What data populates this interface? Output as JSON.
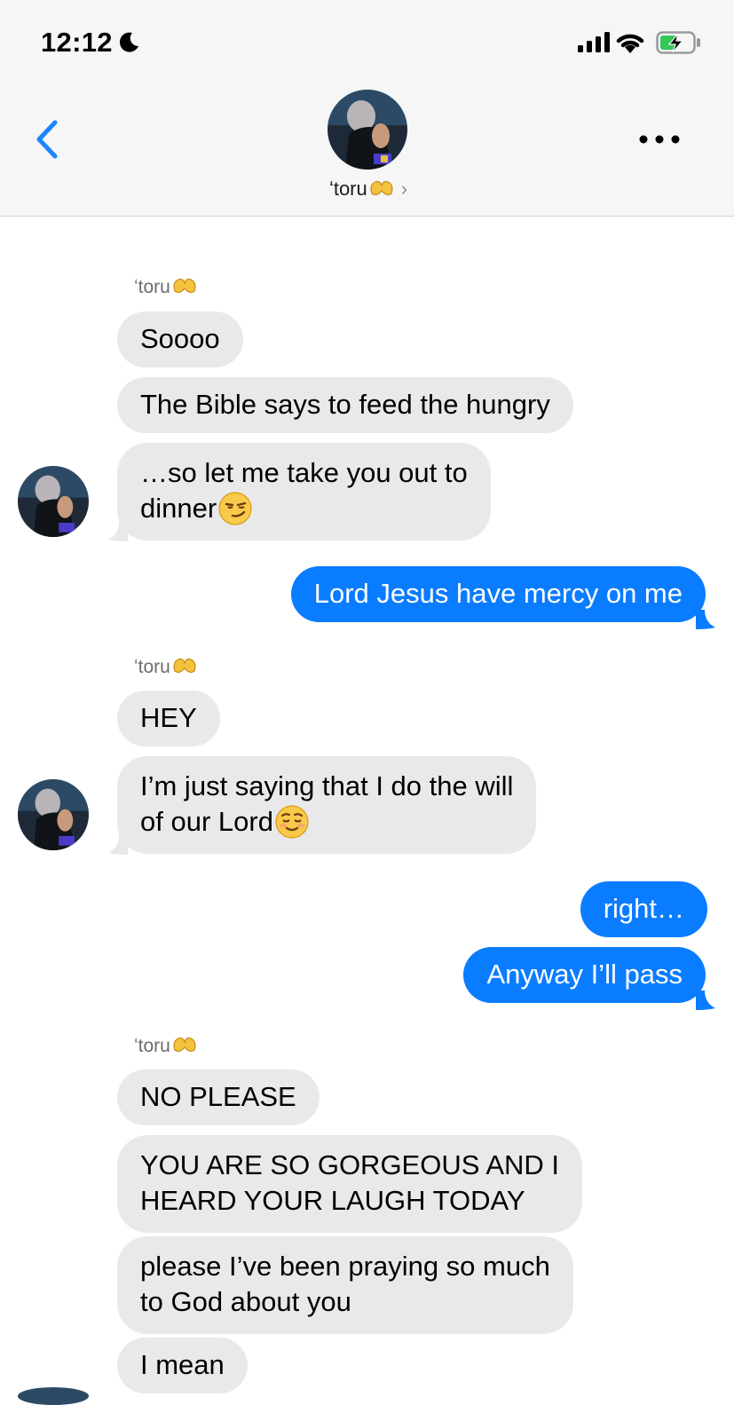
{
  "status_bar": {
    "time": "12:12",
    "icons": [
      "moon-icon",
      "cellular-signal-icon",
      "wifi-icon",
      "battery-charging-icon"
    ]
  },
  "header": {
    "contact_name": "ʻtoru",
    "contact_emoji": "heart-hands-emoji",
    "chevron": "›",
    "back_icon": "chevron-left-icon",
    "menu_icon": "more-dots-icon"
  },
  "colors": {
    "outgoing_bubble": "#0a7cff",
    "incoming_bubble": "#e9e9eb",
    "accent": "#1d84ff"
  },
  "messages": [
    {
      "sender": "ʻtoru",
      "direction": "in",
      "text": "Soooo"
    },
    {
      "direction": "in",
      "text": "The Bible says to feed the hungry"
    },
    {
      "direction": "in",
      "lines": [
        "…so let me take you out to",
        "dinner"
      ],
      "emoji": "smirking-face-emoji"
    },
    {
      "direction": "out",
      "text": "Lord Jesus have mercy on me"
    },
    {
      "sender": "ʻtoru",
      "direction": "in",
      "text": "HEY"
    },
    {
      "direction": "in",
      "lines": [
        "I’m just saying that I do the will",
        "of our Lord"
      ],
      "emoji": "relieved-face-emoji"
    },
    {
      "direction": "out",
      "text": "right…"
    },
    {
      "direction": "out",
      "text": "Anyway I’ll pass"
    },
    {
      "sender": "ʻtoru",
      "direction": "in",
      "text": "NO PLEASE"
    },
    {
      "direction": "in",
      "lines": [
        "YOU ARE SO GORGEOUS AND I",
        "HEARD YOUR LAUGH TODAY"
      ]
    },
    {
      "direction": "in",
      "lines": [
        "please I’ve been praying so much",
        "to God about you"
      ]
    },
    {
      "direction": "in",
      "text": "I mean"
    }
  ]
}
